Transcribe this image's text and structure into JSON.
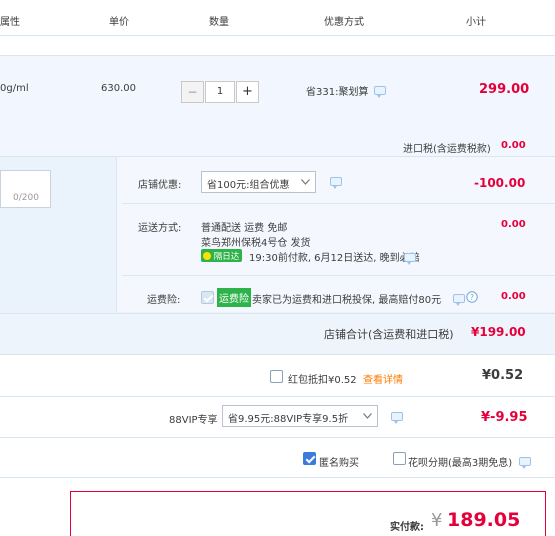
{
  "header": {
    "col_attr": "属性",
    "col_price": "单价",
    "col_qty": "数量",
    "col_promo": "优惠方式",
    "col_subtotal": "小计"
  },
  "item": {
    "spec": "0g/ml",
    "price": "630.00",
    "minus": "−",
    "qty": "1",
    "plus": "+",
    "promo": "省331:聚划算",
    "subtotal": "299.00"
  },
  "tax": {
    "label": "进口税(含运费税款)",
    "value": "0.00"
  },
  "message": {
    "counter": "0/200"
  },
  "shop": {
    "discount_label": "店铺优惠:",
    "discount_select": "省100元:组合优惠",
    "discount_value": "-100.00",
    "shipping_label": "运送方式:",
    "shipping_line1": "普通配送 运费 免邮",
    "shipping_line2": "菜鸟郑州保税4号仓   发货",
    "shipping_badge": "隔日达",
    "shipping_line3": "19:30前付款, 6月12日送达, 晚到必赔",
    "shipping_value": "0.00",
    "insurance_label": "运费险:",
    "insurance_badge": "运费险",
    "insurance_text": "卖家已为运费和进口税投保, 最高赔付80元",
    "insurance_value": "0.00",
    "total_label": "店铺合计(含运费和进口税)",
    "total_value": "¥199.00"
  },
  "redpacket": {
    "label": "红包抵扣¥0.52",
    "link": "查看详情",
    "value": "¥0.52"
  },
  "vip": {
    "label": "88VIP专享",
    "select": "省9.95元:88VIP专享9.5折",
    "value": "¥-9.95"
  },
  "options": {
    "anonymous": "匿名购买",
    "anonymous_checked": true,
    "huabei": "花呗分期(最高3期免息)",
    "huabei_checked": false
  },
  "payment": {
    "label": "实付款:",
    "currency": "¥",
    "amount": "189.05"
  },
  "colors": {
    "accent_red": "#e4003a",
    "orange_red": "#ff4400",
    "link_orange": "#ff7a00",
    "green_badge": "#2db34a",
    "panel_blue": "#f2f7ff",
    "border_blue": "#d9e6ef"
  }
}
